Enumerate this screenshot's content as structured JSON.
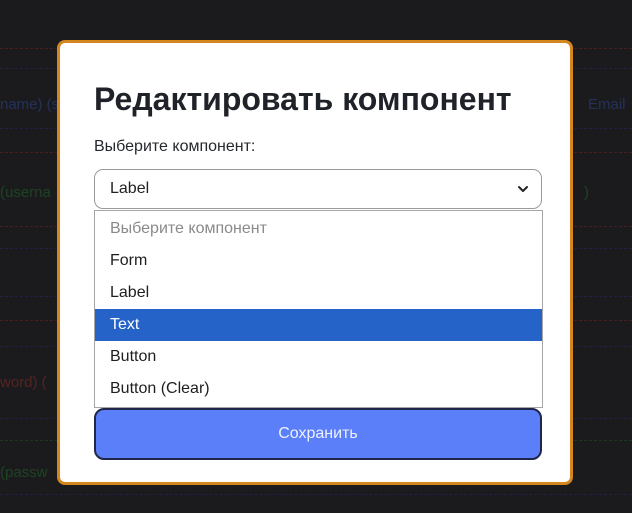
{
  "background": {
    "fragments": [
      "name) (s",
      "Email",
      "(userna",
      ")",
      "word) (",
      "(passw"
    ]
  },
  "modal": {
    "title": "Редактировать компонент",
    "select_label": "Выберите компонент:",
    "selected_value": "Label",
    "dropdown_options": [
      {
        "label": "Выберите компонент",
        "state": "placeholder"
      },
      {
        "label": "Form",
        "state": "normal"
      },
      {
        "label": "Label",
        "state": "normal"
      },
      {
        "label": "Text",
        "state": "highlighted"
      },
      {
        "label": "Button",
        "state": "normal"
      },
      {
        "label": "Button (Clear)",
        "state": "normal"
      }
    ],
    "save_button": "Сохранить"
  },
  "colors": {
    "modal_border": "#d4861f",
    "button_fill": "#5b7ff8",
    "highlight": "#2563c9"
  },
  "icons": {
    "select_arrow": "chevron-down-icon"
  }
}
